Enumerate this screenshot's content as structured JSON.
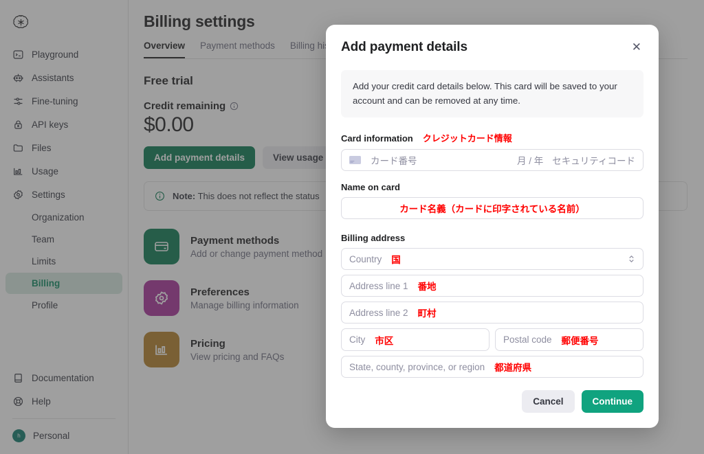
{
  "sidebar": {
    "brand_icon": "openai-logo",
    "items": [
      {
        "label": "Playground",
        "icon": "terminal-icon"
      },
      {
        "label": "Assistants",
        "icon": "robot-icon"
      },
      {
        "label": "Fine-tuning",
        "icon": "sliders-icon"
      },
      {
        "label": "API keys",
        "icon": "lock-icon"
      },
      {
        "label": "Files",
        "icon": "folder-icon"
      },
      {
        "label": "Usage",
        "icon": "bar-chart-icon"
      },
      {
        "label": "Settings",
        "icon": "gear-icon"
      }
    ],
    "sub_items": [
      {
        "label": "Organization",
        "active": false
      },
      {
        "label": "Team",
        "active": false
      },
      {
        "label": "Limits",
        "active": false
      },
      {
        "label": "Billing",
        "active": true
      },
      {
        "label": "Profile",
        "active": false
      }
    ],
    "bottom_items": [
      {
        "label": "Documentation",
        "icon": "book-icon"
      },
      {
        "label": "Help",
        "icon": "lifebuoy-icon"
      }
    ],
    "account": {
      "label": "Personal",
      "avatar_initial": "h",
      "avatar_color": "#0f7a6c"
    }
  },
  "main": {
    "page_title": "Billing settings",
    "tabs": [
      {
        "label": "Overview",
        "active": true
      },
      {
        "label": "Payment methods",
        "active": false
      },
      {
        "label": "Billing history",
        "active": false
      }
    ],
    "plan_title": "Free trial",
    "credit_label": "Credit remaining",
    "credit_info_icon": "info-icon",
    "amount": "$0.00",
    "primary_button": "Add payment details",
    "secondary_button": "View usage",
    "note_icon": "info-circle-icon",
    "note_bold": "Note:",
    "note_text": "This does not reflect the status",
    "cards": [
      {
        "title": "Payment methods",
        "subtitle": "Add or change payment method",
        "icon": "credit-card-icon",
        "color": "#0d7a52"
      },
      {
        "title": "Preferences",
        "subtitle": "Manage billing information",
        "icon": "gear-icon",
        "color": "#a8329b"
      },
      {
        "title": "Pricing",
        "subtitle": "View pricing and FAQs",
        "icon": "bar-chart-icon",
        "color": "#b5812a"
      }
    ]
  },
  "modal": {
    "title": "Add payment details",
    "close_icon": "close-icon",
    "info_text": "Add your credit card details below. This card will be saved to your account and can be removed at any time.",
    "card_information": {
      "label": "Card information",
      "annotation": "クレジットカード情報",
      "card_icon": "credit-card-icon",
      "number_placeholder": "カード番号",
      "expiry_placeholder": "月 / 年",
      "cvc_placeholder": "セキュリティコード"
    },
    "name_on_card": {
      "label": "Name on card",
      "annotation": "カード名義（カードに印字されている名前）"
    },
    "billing_address": {
      "label": "Billing address",
      "fields": [
        {
          "placeholder": "Country",
          "annotation": "国",
          "icon": "chevron-updown-icon"
        },
        {
          "placeholder": "Address line 1",
          "annotation": "番地"
        },
        {
          "placeholder": "Address line 2",
          "annotation": "町村"
        },
        {
          "placeholder": "City",
          "annotation": "市区"
        },
        {
          "placeholder": "Postal code",
          "annotation": "郵便番号"
        },
        {
          "placeholder": "State, county, province, or region",
          "annotation": "都道府県"
        }
      ]
    },
    "cancel_button": "Cancel",
    "continue_button": "Continue"
  },
  "colors": {
    "accent_green": "#10a37f",
    "primary_green": "#0a7a52",
    "annotation_red": "#ff0000",
    "scrim": "rgba(64,64,64,0.5)"
  }
}
